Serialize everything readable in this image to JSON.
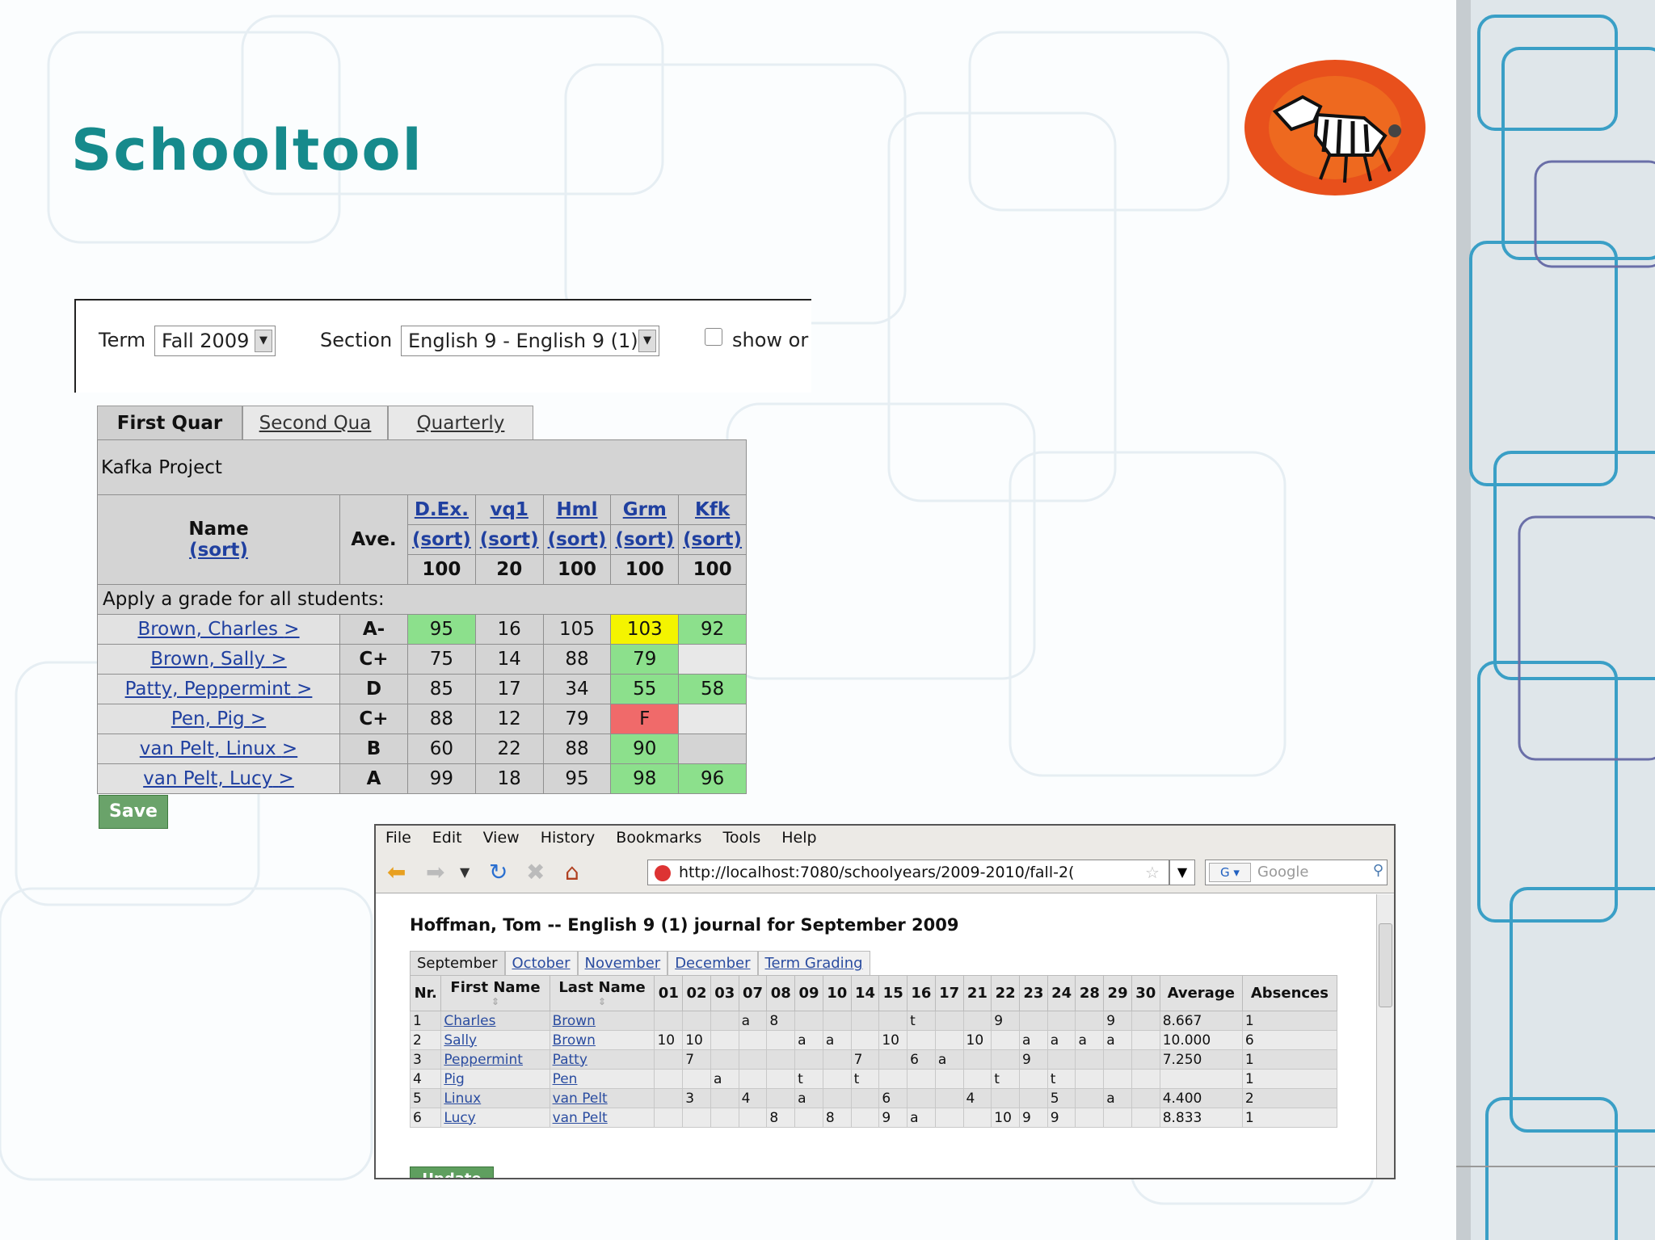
{
  "slide": {
    "title": "Schooltool"
  },
  "gradebook": {
    "term_label": "Term",
    "term_value": "Fall 2009",
    "section_label": "Section",
    "section_value": "English 9 - English 9 (1)",
    "show_only_label": "show or",
    "tabs": [
      {
        "label": "First Quar",
        "active": true
      },
      {
        "label": "Second Qua",
        "active": false
      },
      {
        "label": "Quarterly",
        "active": false
      }
    ],
    "project": "Kafka Project",
    "name_header": "Name",
    "sort_label": "(sort)",
    "ave_header": "Ave.",
    "activities": [
      {
        "name": "D.Ex.",
        "max": "100"
      },
      {
        "name": "vq1",
        "max": "20"
      },
      {
        "name": "Hml",
        "max": "100"
      },
      {
        "name": "Grm",
        "max": "100"
      },
      {
        "name": "Kfk",
        "max": "100"
      }
    ],
    "apply_label": "Apply a grade for all students:",
    "students": [
      {
        "name": "Brown, Charles",
        "ave": "A-",
        "scores": [
          "95",
          "16",
          "105",
          "103",
          "92"
        ],
        "colors": [
          "#8ce08c",
          "",
          "",
          "#f4f400",
          "#8ce08c"
        ]
      },
      {
        "name": "Brown, Sally",
        "ave": "C+",
        "scores": [
          "75",
          "14",
          "88",
          "79",
          ""
        ],
        "colors": [
          "",
          "",
          "",
          "#8ce08c",
          "#e8e8e8"
        ]
      },
      {
        "name": "Patty, Peppermint",
        "ave": "D",
        "scores": [
          "85",
          "17",
          "34",
          "55",
          "58"
        ],
        "colors": [
          "",
          "",
          "",
          "#8ce08c",
          "#8ce08c"
        ]
      },
      {
        "name": "Pen, Pig",
        "ave": "C+",
        "scores": [
          "88",
          "12",
          "79",
          "F",
          ""
        ],
        "colors": [
          "",
          "",
          "",
          "#f06a6a",
          "#e8e8e8"
        ]
      },
      {
        "name": "van Pelt, Linux",
        "ave": "B",
        "scores": [
          "60",
          "22",
          "88",
          "90",
          ""
        ],
        "colors": [
          "",
          "",
          "",
          "#8ce08c",
          ""
        ]
      },
      {
        "name": "van Pelt, Lucy",
        "ave": "A",
        "scores": [
          "99",
          "18",
          "95",
          "98",
          "96"
        ],
        "colors": [
          "",
          "",
          "",
          "#8ce08c",
          "#8ce08c"
        ]
      }
    ],
    "arrow": ">",
    "save_label": "Save"
  },
  "browser": {
    "menu": [
      "File",
      "Edit",
      "View",
      "History",
      "Bookmarks",
      "Tools",
      "Help"
    ],
    "url": "http://localhost:7080/schoolyears/2009-2010/fall-2(",
    "search_placeholder": "Google",
    "search_engine": "G",
    "journal_title": "Hoffman, Tom -- English 9 (1) journal for September 2009",
    "tabs": [
      {
        "label": "September",
        "active": true
      },
      {
        "label": "October",
        "active": false
      },
      {
        "label": "November",
        "active": false
      },
      {
        "label": "December",
        "active": false
      },
      {
        "label": "Term Grading",
        "active": false
      }
    ],
    "columns": {
      "nr": "Nr.",
      "first": "First Name",
      "last": "Last Name",
      "average": "Average",
      "absences": "Absences"
    },
    "days": [
      "01",
      "02",
      "03",
      "07",
      "08",
      "09",
      "10",
      "14",
      "15",
      "16",
      "17",
      "21",
      "22",
      "23",
      "24",
      "28",
      "29",
      "30"
    ],
    "rows": [
      {
        "nr": "1",
        "first": "Charles",
        "last": "Brown",
        "cells": [
          "",
          "",
          "",
          "a",
          "8",
          "",
          "",
          "",
          "",
          "t",
          "",
          "",
          "9",
          "",
          "",
          "",
          "9",
          ""
        ],
        "average": "8.667",
        "absences": "1"
      },
      {
        "nr": "2",
        "first": "Sally",
        "last": "Brown",
        "cells": [
          "10",
          "10",
          "",
          "",
          "",
          "a",
          "a",
          "",
          "10",
          "",
          "",
          "10",
          "",
          "a",
          "a",
          "a",
          "a",
          ""
        ],
        "average": "10.000",
        "absences": "6"
      },
      {
        "nr": "3",
        "first": "Peppermint",
        "last": "Patty",
        "cells": [
          "",
          "7",
          "",
          "",
          "",
          "",
          "",
          "7",
          "",
          "6",
          "a",
          "",
          "",
          "9",
          "",
          "",
          "",
          ""
        ],
        "average": "7.250",
        "absences": "1"
      },
      {
        "nr": "4",
        "first": "Pig",
        "last": "Pen",
        "cells": [
          "",
          "",
          "a",
          "",
          "",
          "t",
          "",
          "t",
          "",
          "",
          "",
          "",
          "t",
          "",
          "t",
          "",
          "",
          ""
        ],
        "average": "",
        "absences": "1"
      },
      {
        "nr": "5",
        "first": "Linux",
        "last": "van Pelt",
        "cells": [
          "",
          "3",
          "",
          "4",
          "",
          "a",
          "",
          "",
          "6",
          "",
          "",
          "4",
          "",
          "",
          "5",
          "",
          "a",
          ""
        ],
        "average": "4.400",
        "absences": "2"
      },
      {
        "nr": "6",
        "first": "Lucy",
        "last": "van Pelt",
        "cells": [
          "",
          "",
          "",
          "",
          "8",
          "",
          "8",
          "",
          "9",
          "a",
          "",
          "",
          "10",
          "9",
          "9",
          "",
          "",
          ""
        ],
        "average": "8.833",
        "absences": "1"
      }
    ],
    "update_label": "Update"
  },
  "icons": [
    "back-arrow-icon",
    "forward-arrow-icon",
    "history-dropdown-icon",
    "reload-icon",
    "stop-icon",
    "home-icon",
    "site-security-icon",
    "bookmark-star-icon",
    "search-magnifier-icon",
    "zebra-logo"
  ]
}
